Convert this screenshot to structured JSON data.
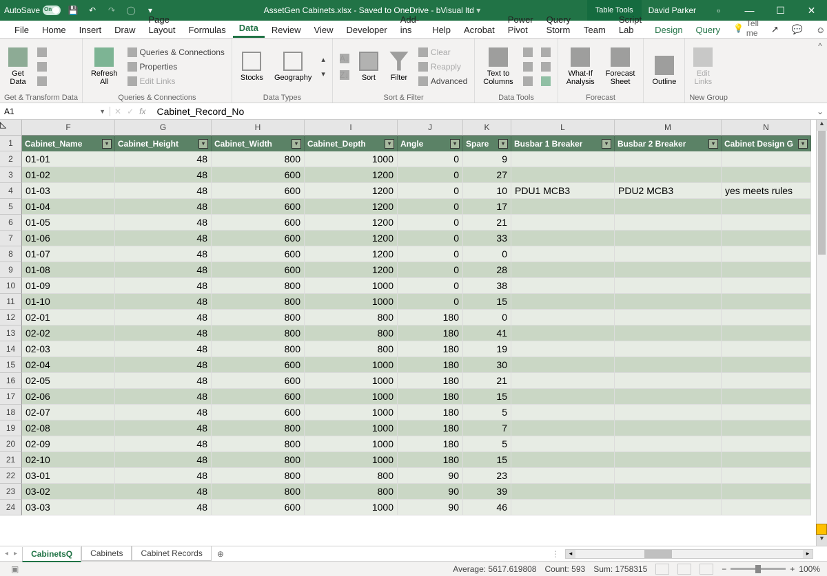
{
  "titlebar": {
    "autosave": "AutoSave",
    "filename": "AssetGen Cabinets.xlsx - Saved to OneDrive - bVisual ltd",
    "tabletools": "Table Tools",
    "user": "David Parker"
  },
  "tabs": {
    "file": "File",
    "home": "Home",
    "insert": "Insert",
    "draw": "Draw",
    "page_layout": "Page Layout",
    "formulas": "Formulas",
    "data": "Data",
    "review": "Review",
    "view": "View",
    "developer": "Developer",
    "addins": "Add-ins",
    "help": "Help",
    "acrobat": "Acrobat",
    "powerpivot": "Power Pivot",
    "querystorm": "Query Storm",
    "team": "Team",
    "scriptlab": "Script Lab",
    "design": "Design",
    "query": "Query",
    "tellme": "Tell me"
  },
  "ribbon": {
    "get_data": "Get\nData",
    "refresh_all": "Refresh\nAll",
    "queries_conn": "Queries & Connections",
    "properties": "Properties",
    "edit_links": "Edit Links",
    "stocks": "Stocks",
    "geography": "Geography",
    "sort": "Sort",
    "filter": "Filter",
    "clear": "Clear",
    "reapply": "Reapply",
    "advanced": "Advanced",
    "text_to_cols": "Text to\nColumns",
    "whatif": "What-If\nAnalysis",
    "forecast_sheet": "Forecast\nSheet",
    "outline": "Outline",
    "edit_links2": "Edit\nLinks",
    "grp_get": "Get & Transform Data",
    "grp_qc": "Queries & Connections",
    "grp_dt": "Data Types",
    "grp_sf": "Sort & Filter",
    "grp_tools": "Data Tools",
    "grp_forecast": "Forecast",
    "grp_new": "New Group"
  },
  "formulabar": {
    "cell_ref": "A1",
    "formula": "Cabinet_Record_No"
  },
  "columns": [
    "F",
    "G",
    "H",
    "I",
    "J",
    "K",
    "L",
    "M",
    "N"
  ],
  "headers": [
    "Cabinet_Name",
    "Cabinet_Height",
    "Cabinet_Width",
    "Cabinet_Depth",
    "Angle",
    "Spare",
    "Busbar 1 Breaker",
    "Busbar 2 Breaker",
    "Cabinet Design G"
  ],
  "rows": [
    {
      "n": 2,
      "d": [
        "01-01",
        "48",
        "800",
        "1000",
        "0",
        "9",
        "",
        "",
        ""
      ]
    },
    {
      "n": 3,
      "d": [
        "01-02",
        "48",
        "600",
        "1200",
        "0",
        "27",
        "",
        "",
        ""
      ]
    },
    {
      "n": 4,
      "d": [
        "01-03",
        "48",
        "600",
        "1200",
        "0",
        "10",
        "PDU1 MCB3",
        "PDU2 MCB3",
        "yes meets rules"
      ]
    },
    {
      "n": 5,
      "d": [
        "01-04",
        "48",
        "600",
        "1200",
        "0",
        "17",
        "",
        "",
        ""
      ]
    },
    {
      "n": 6,
      "d": [
        "01-05",
        "48",
        "600",
        "1200",
        "0",
        "21",
        "",
        "",
        ""
      ]
    },
    {
      "n": 7,
      "d": [
        "01-06",
        "48",
        "600",
        "1200",
        "0",
        "33",
        "",
        "",
        ""
      ]
    },
    {
      "n": 8,
      "d": [
        "01-07",
        "48",
        "600",
        "1200",
        "0",
        "0",
        "",
        "",
        ""
      ]
    },
    {
      "n": 9,
      "d": [
        "01-08",
        "48",
        "600",
        "1200",
        "0",
        "28",
        "",
        "",
        ""
      ]
    },
    {
      "n": 10,
      "d": [
        "01-09",
        "48",
        "800",
        "1000",
        "0",
        "38",
        "",
        "",
        ""
      ]
    },
    {
      "n": 11,
      "d": [
        "01-10",
        "48",
        "800",
        "1000",
        "0",
        "15",
        "",
        "",
        ""
      ]
    },
    {
      "n": 12,
      "d": [
        "02-01",
        "48",
        "800",
        "800",
        "180",
        "0",
        "",
        "",
        ""
      ]
    },
    {
      "n": 13,
      "d": [
        "02-02",
        "48",
        "800",
        "800",
        "180",
        "41",
        "",
        "",
        ""
      ]
    },
    {
      "n": 14,
      "d": [
        "02-03",
        "48",
        "800",
        "800",
        "180",
        "19",
        "",
        "",
        ""
      ]
    },
    {
      "n": 15,
      "d": [
        "02-04",
        "48",
        "600",
        "1000",
        "180",
        "30",
        "",
        "",
        ""
      ]
    },
    {
      "n": 16,
      "d": [
        "02-05",
        "48",
        "600",
        "1000",
        "180",
        "21",
        "",
        "",
        ""
      ]
    },
    {
      "n": 17,
      "d": [
        "02-06",
        "48",
        "600",
        "1000",
        "180",
        "15",
        "",
        "",
        ""
      ]
    },
    {
      "n": 18,
      "d": [
        "02-07",
        "48",
        "600",
        "1000",
        "180",
        "5",
        "",
        "",
        ""
      ]
    },
    {
      "n": 19,
      "d": [
        "02-08",
        "48",
        "800",
        "1000",
        "180",
        "7",
        "",
        "",
        ""
      ]
    },
    {
      "n": 20,
      "d": [
        "02-09",
        "48",
        "800",
        "1000",
        "180",
        "5",
        "",
        "",
        ""
      ]
    },
    {
      "n": 21,
      "d": [
        "02-10",
        "48",
        "800",
        "1000",
        "180",
        "15",
        "",
        "",
        ""
      ]
    },
    {
      "n": 22,
      "d": [
        "03-01",
        "48",
        "800",
        "800",
        "90",
        "23",
        "",
        "",
        ""
      ]
    },
    {
      "n": 23,
      "d": [
        "03-02",
        "48",
        "800",
        "800",
        "90",
        "39",
        "",
        "",
        ""
      ]
    },
    {
      "n": 24,
      "d": [
        "03-03",
        "48",
        "600",
        "1000",
        "90",
        "46",
        "",
        "",
        ""
      ]
    }
  ],
  "sheets": {
    "s1": "CabinetsQ",
    "s2": "Cabinets",
    "s3": "Cabinet Records"
  },
  "status": {
    "avg": "Average: 5617.619808",
    "count": "Count: 593",
    "sum": "Sum: 1758315",
    "zoom": "100%"
  }
}
